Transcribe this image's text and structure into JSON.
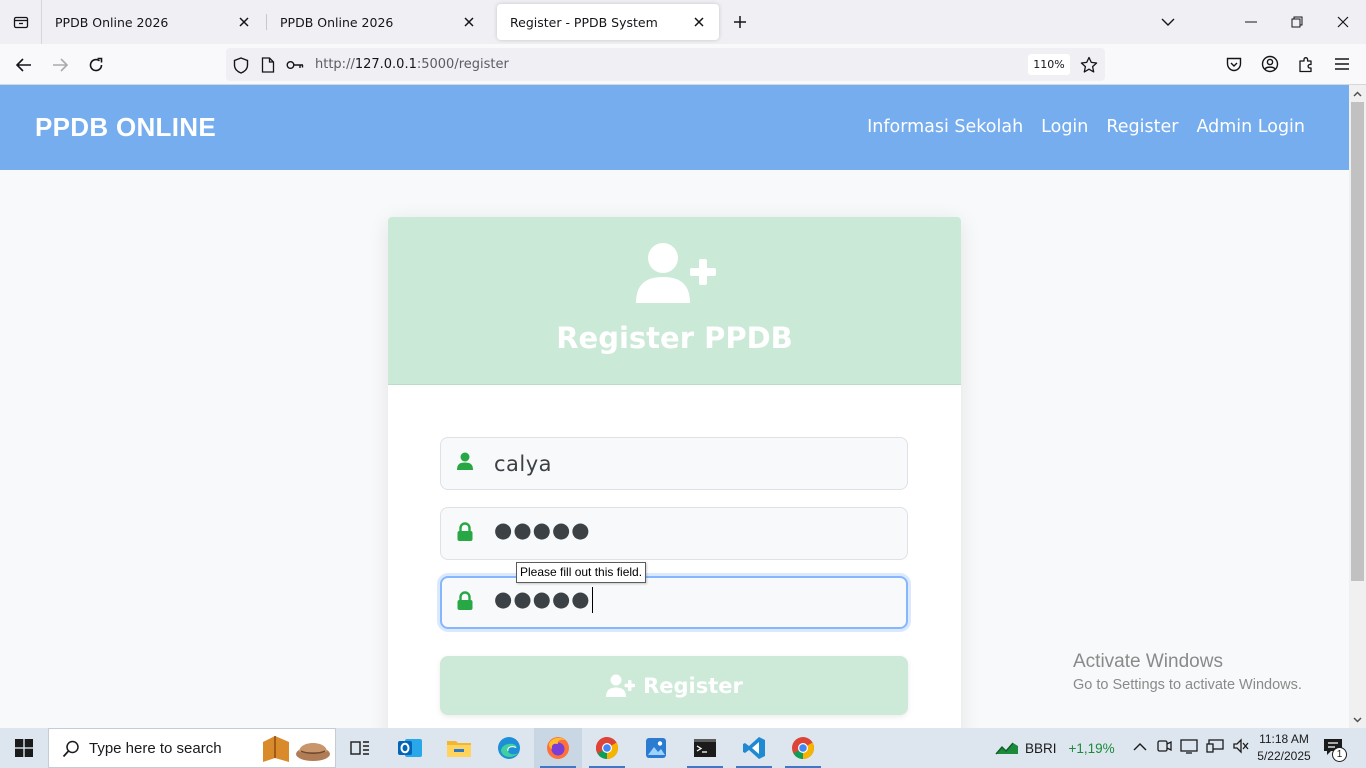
{
  "browser": {
    "tabs": [
      {
        "title": "PPDB Online 2026"
      },
      {
        "title": "PPDB Online 2026"
      },
      {
        "title": "Register - PPDB System"
      }
    ],
    "url_prefix": "http://",
    "url_host": "127.0.0.1",
    "url_path": ":5000/register",
    "zoom": "110%"
  },
  "site": {
    "brand": "PPDB ONLINE",
    "nav": [
      "Informasi Sekolah",
      "Login",
      "Register",
      "Admin Login"
    ]
  },
  "form": {
    "title": "Register PPDB",
    "username_value": "calya",
    "password_masked": "●●●●●",
    "confirm_masked": "●●●●●",
    "tooltip": "Please fill out this field.",
    "submit_label": "Register"
  },
  "watermark": {
    "line1": "Activate Windows",
    "line2": "Go to Settings to activate Windows."
  },
  "taskbar": {
    "search_placeholder": "Type here to search",
    "stock_name": "BBRI",
    "stock_change": "+1,19%",
    "time": "11:18 AM",
    "date": "5/22/2025",
    "notification_count": "1"
  },
  "colors": {
    "header": "#75adee",
    "card_header": "#cbe9d7",
    "icon_green": "#28a745",
    "focus_border": "#86b7fe"
  }
}
